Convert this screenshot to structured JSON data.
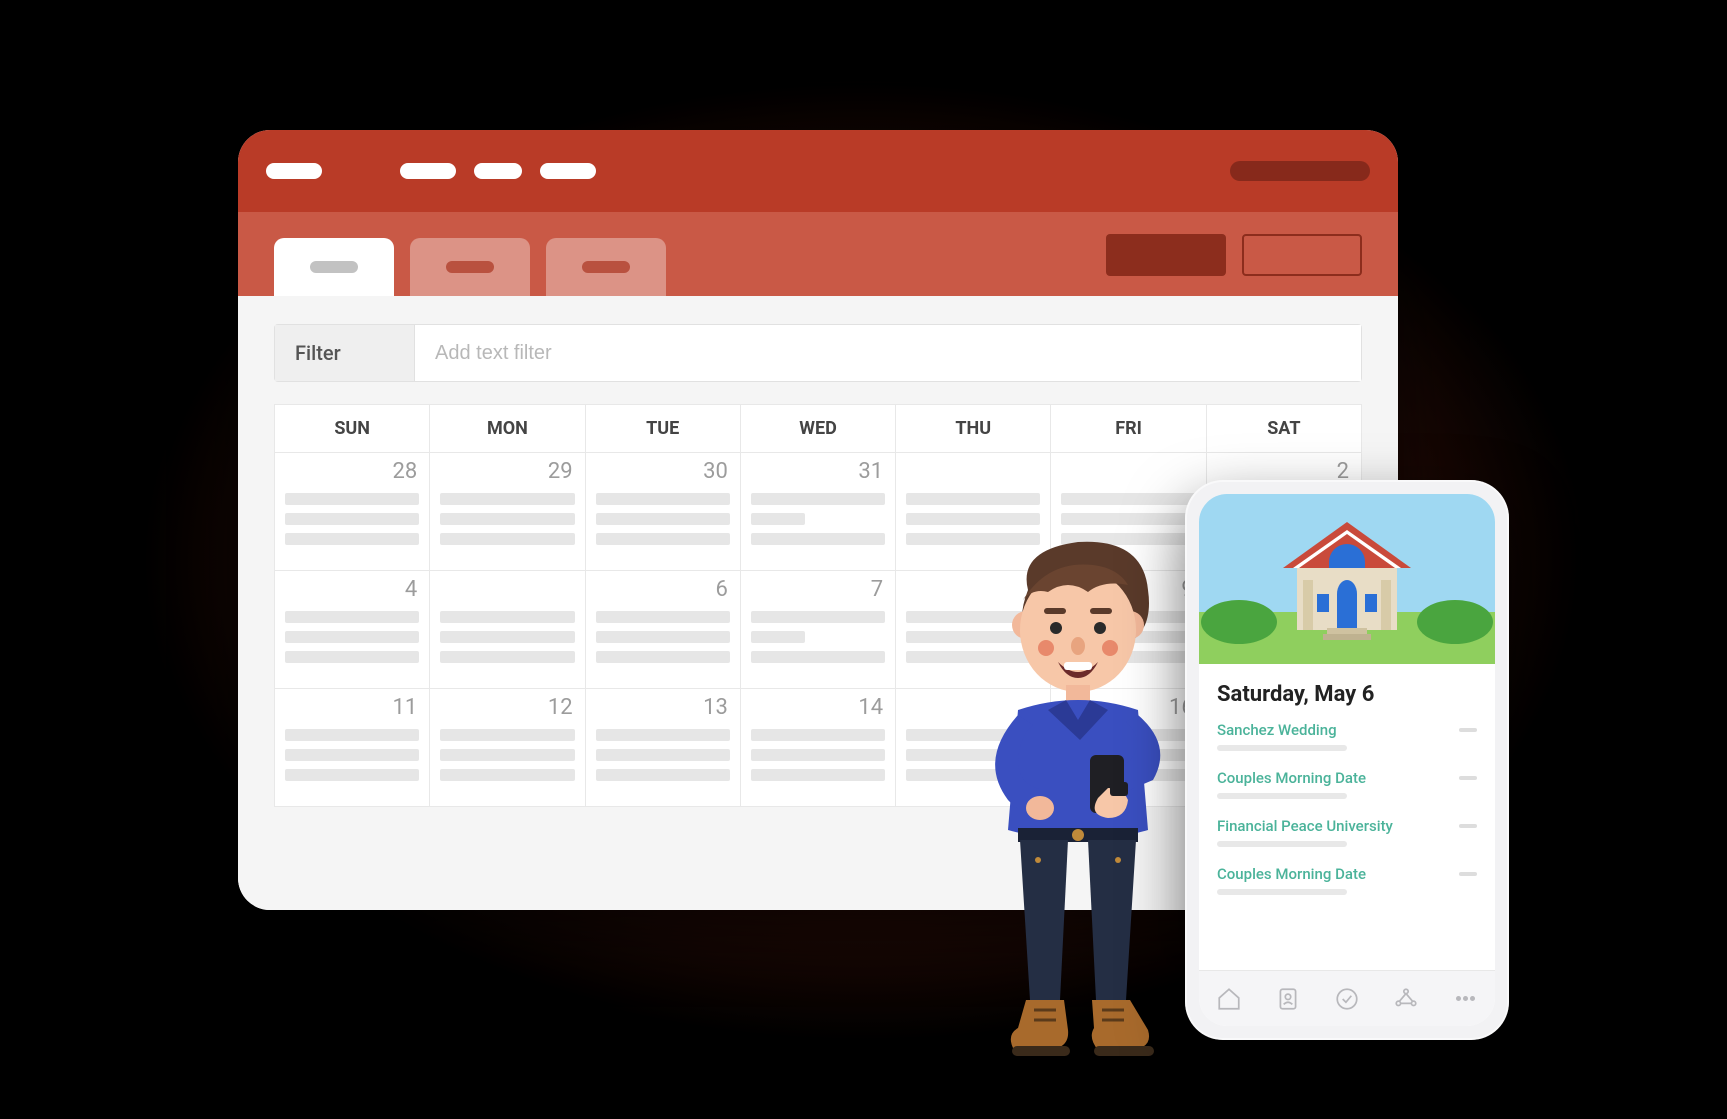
{
  "filter": {
    "label": "Filter",
    "placeholder": "Add text filter"
  },
  "calendar": {
    "day_headers": [
      "SUN",
      "MON",
      "TUE",
      "WED",
      "THU",
      "FRI",
      "SAT"
    ],
    "rows": [
      [
        "28",
        "29",
        "30",
        "31",
        "",
        "",
        "2"
      ],
      [
        "4",
        "",
        "6",
        "7",
        "",
        "9",
        ""
      ],
      [
        "11",
        "12",
        "13",
        "14",
        "",
        "16",
        ""
      ]
    ]
  },
  "phone": {
    "date_heading": "Saturday, May 6",
    "events": [
      {
        "title": "Sanchez Wedding"
      },
      {
        "title": "Couples Morning Date"
      },
      {
        "title": "Financial Peace University"
      },
      {
        "title": "Couples Morning Date"
      }
    ]
  },
  "colors": {
    "brand_red": "#c95946",
    "brand_red_dark": "#b93b27",
    "accent_teal": "#4bb39a"
  }
}
